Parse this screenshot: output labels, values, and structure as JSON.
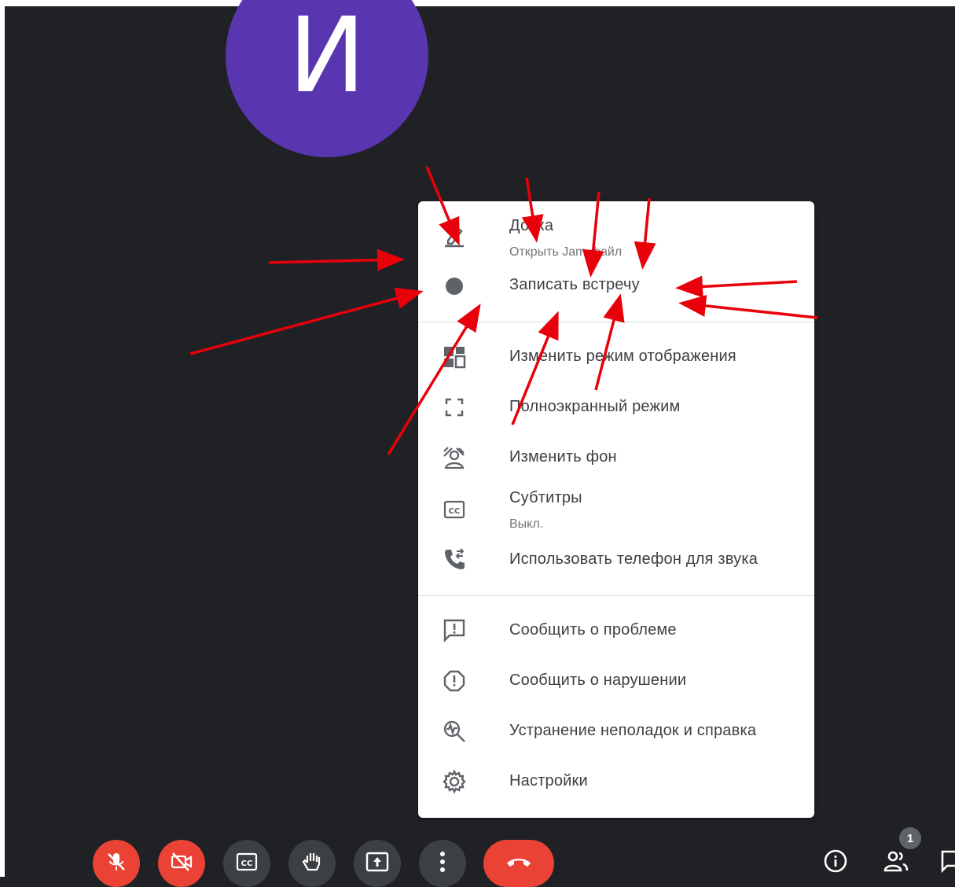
{
  "participant": {
    "avatar_letter": "И",
    "avatar_color": "#5a35b0"
  },
  "menu": {
    "sections": [
      [
        {
          "icon": "pen-board-icon",
          "label": "Доска",
          "sub": "Открыть Jam-файл"
        },
        {
          "icon": "record-dot-icon",
          "label": "Записать встречу"
        }
      ],
      [
        {
          "icon": "layout-icon",
          "label": "Изменить режим отображения"
        },
        {
          "icon": "fullscreen-icon",
          "label": "Полноэкранный режим"
        },
        {
          "icon": "background-icon",
          "label": "Изменить фон"
        },
        {
          "icon": "cc-icon",
          "label": "Субтитры",
          "sub": "Выкл."
        },
        {
          "icon": "phone-audio-icon",
          "label": "Использовать телефон для звука"
        }
      ],
      [
        {
          "icon": "feedback-icon",
          "label": "Сообщить о проблеме"
        },
        {
          "icon": "report-icon",
          "label": "Сообщить о нарушении"
        },
        {
          "icon": "troubleshoot-icon",
          "label": "Устранение неполадок и справка"
        },
        {
          "icon": "gear-icon",
          "label": "Настройки"
        }
      ]
    ]
  },
  "controls": {
    "buttons": [
      "mic-off-icon",
      "camera-off-icon",
      "cc-icon",
      "raise-hand-icon",
      "present-icon",
      "more-vert-icon",
      "end-call-icon"
    ],
    "people_count": "1"
  },
  "colors": {
    "accent_red": "#ea4335",
    "dark_bg": "#202124",
    "annotation_red": "#e8000b"
  }
}
